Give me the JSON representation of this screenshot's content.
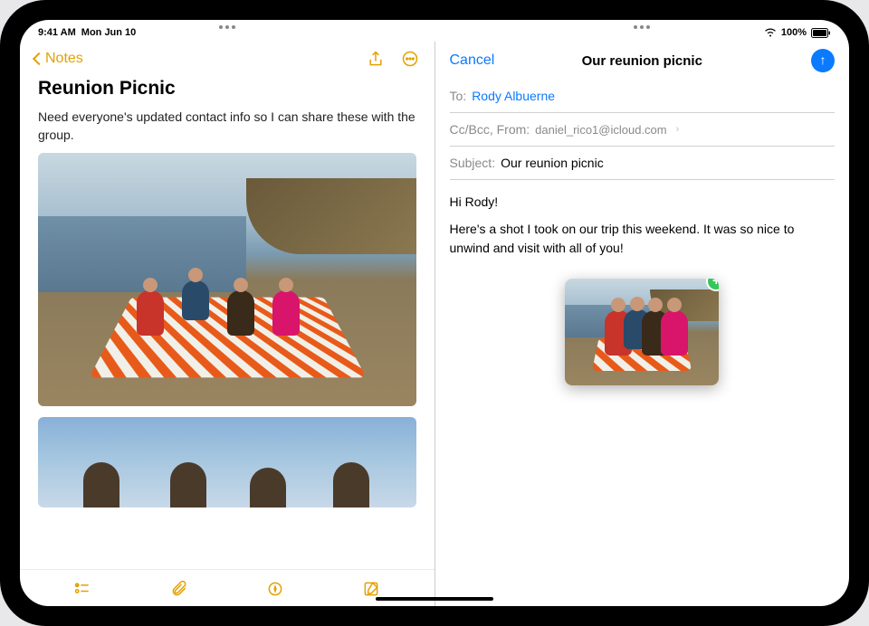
{
  "status": {
    "time": "9:41 AM",
    "date": "Mon Jun 10",
    "battery": "100%"
  },
  "notes": {
    "back_label": "Notes",
    "title": "Reunion Picnic",
    "body": "Need everyone's updated contact info so I can share these with the group."
  },
  "mail": {
    "cancel": "Cancel",
    "title": "Our reunion picnic",
    "to_label": "To:",
    "to_value": "Rody Albuerne",
    "ccbcc_label": "Cc/Bcc, From:",
    "from_email": "daniel_rico1@icloud.com",
    "subject_label": "Subject:",
    "subject_value": "Our reunion picnic",
    "body_greeting": "Hi Rody!",
    "body_text": "Here's a shot I took on our trip this weekend. It was so nice to unwind and visit with all of you!"
  }
}
